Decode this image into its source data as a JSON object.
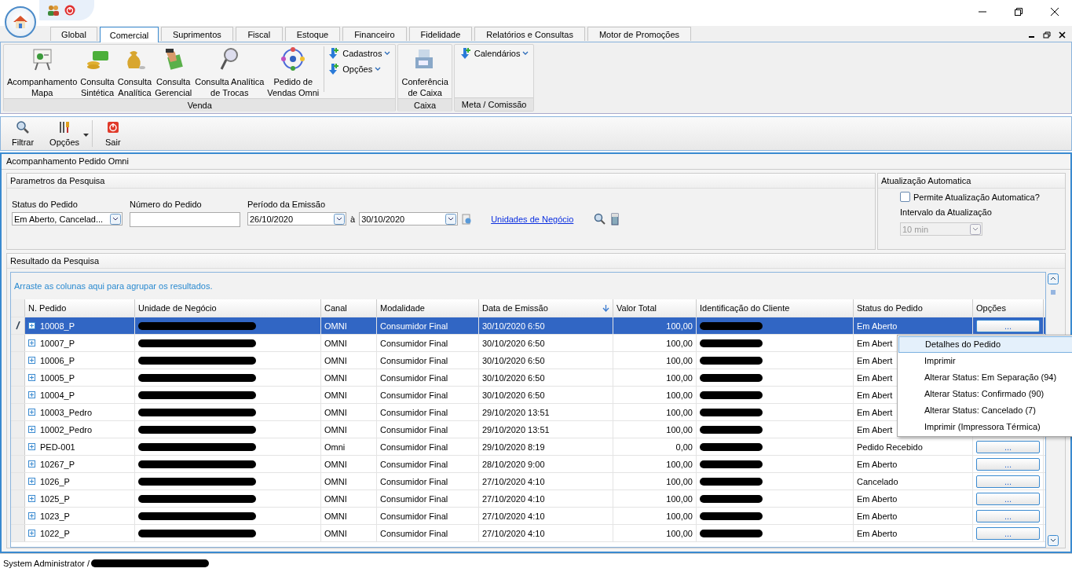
{
  "tabs": [
    {
      "label": "Global",
      "selected": false
    },
    {
      "label": "Comercial",
      "selected": true
    },
    {
      "label": "Suprimentos",
      "selected": false
    },
    {
      "label": "Fiscal",
      "selected": false
    },
    {
      "label": "Estoque",
      "selected": false
    },
    {
      "label": "Financeiro",
      "selected": false
    },
    {
      "label": "Fidelidade",
      "selected": false
    },
    {
      "label": "Relatórios e Consultas",
      "selected": false
    },
    {
      "label": "Motor de Promoções",
      "selected": false
    }
  ],
  "ribbon_groups": [
    {
      "label": "Venda",
      "buttons": [
        {
          "lines": [
            "Acompanhamento",
            "Mapa"
          ],
          "kind": "board"
        },
        {
          "lines": [
            "Consulta",
            "Sintética"
          ],
          "kind": "money"
        },
        {
          "lines": [
            "Consulta",
            "Analítica"
          ],
          "kind": "bag"
        },
        {
          "lines": [
            "Consulta",
            "Gerencial"
          ],
          "kind": "hand"
        },
        {
          "lines": [
            "Consulta Analítica",
            "de Trocas"
          ],
          "kind": "magnifier"
        },
        {
          "lines": [
            "Pedido de",
            "Vendas Omni"
          ],
          "kind": "network"
        }
      ],
      "menus": [
        "Cadastros",
        "Opções"
      ]
    },
    {
      "label": "Caixa",
      "buttons": [
        {
          "lines": [
            "Conferência",
            "de Caixa"
          ],
          "kind": "register"
        }
      ]
    },
    {
      "label": "Meta / Comissão",
      "menus": [
        "Calendários"
      ]
    }
  ],
  "toolbar": [
    {
      "label": "Filtrar",
      "kind": "search",
      "dropdown": false
    },
    {
      "label": "Opções",
      "kind": "tools",
      "dropdown": true
    },
    {
      "label": "Sair",
      "kind": "exit",
      "dropdown": false
    }
  ],
  "panel_title": "Acompanhamento Pedido Omni",
  "search": {
    "title": "Parametros da Pesquisa",
    "status_label": "Status do Pedido",
    "status_value": "Em Aberto, Cancelad...",
    "number_label": "Número do Pedido",
    "period_label": "Período da Emissão",
    "date_from": "26/10/2020",
    "separator": "à",
    "date_to": "30/10/2020",
    "link": "Unidades de Negócio"
  },
  "auto_update": {
    "title": "Atualização Automatica",
    "checkbox_label": "Permite Atualização Automatica?",
    "checked": false,
    "interval_label": "Intervalo da Atualização",
    "interval_value": "10 min",
    "disabled": true
  },
  "results": {
    "title": "Resultado da Pesquisa",
    "group_hint": "Arraste as colunas aqui para agrupar os resultados.",
    "columns": [
      "N. Pedido",
      "Unidade de Negócio",
      "Canal",
      "Modalidade",
      "Data de Emissão",
      "Valor Total",
      "Identificação do Cliente",
      "Status do Pedido",
      "Opções"
    ],
    "rows": [
      {
        "order": "10008_P",
        "channel": "OMNI",
        "mode": "Consumidor Final",
        "date": "30/10/2020 6:50",
        "total": "100,00",
        "status": "Em Aberto",
        "selected": true,
        "button": "..."
      },
      {
        "order": "10007_P",
        "channel": "OMNI",
        "mode": "Consumidor Final",
        "date": "30/10/2020 6:50",
        "total": "100,00",
        "status": "Em Abert",
        "selected": false
      },
      {
        "order": "10006_P",
        "channel": "OMNI",
        "mode": "Consumidor Final",
        "date": "30/10/2020 6:50",
        "total": "100,00",
        "status": "Em Abert",
        "selected": false
      },
      {
        "order": "10005_P",
        "channel": "OMNI",
        "mode": "Consumidor Final",
        "date": "30/10/2020 6:50",
        "total": "100,00",
        "status": "Em Abert",
        "selected": false
      },
      {
        "order": "10004_P",
        "channel": "OMNI",
        "mode": "Consumidor Final",
        "date": "30/10/2020 6:50",
        "total": "100,00",
        "status": "Em Abert",
        "selected": false
      },
      {
        "order": "10003_Pedro",
        "channel": "OMNI",
        "mode": "Consumidor Final",
        "date": "29/10/2020 13:51",
        "total": "100,00",
        "status": "Em Abert",
        "selected": false
      },
      {
        "order": "10002_Pedro",
        "channel": "OMNI",
        "mode": "Consumidor Final",
        "date": "29/10/2020 13:51",
        "total": "100,00",
        "status": "Em Abert",
        "selected": false
      },
      {
        "order": "PED-001",
        "channel": "Omni",
        "mode": "Consumidor Final",
        "date": "29/10/2020 8:19",
        "total": "0,00",
        "status": "Pedido Recebido",
        "selected": false,
        "button": "..."
      },
      {
        "order": "10267_P",
        "channel": "OMNI",
        "mode": "Consumidor Final",
        "date": "28/10/2020 9:00",
        "total": "100,00",
        "status": "Em Aberto",
        "selected": false,
        "button": "..."
      },
      {
        "order": "1026_P",
        "channel": "OMNI",
        "mode": "Consumidor Final",
        "date": "27/10/2020 4:10",
        "total": "100,00",
        "status": "Cancelado",
        "selected": false,
        "button": "..."
      },
      {
        "order": "1025_P",
        "channel": "OMNI",
        "mode": "Consumidor Final",
        "date": "27/10/2020 4:10",
        "total": "100,00",
        "status": "Em Aberto",
        "selected": false,
        "button": "..."
      },
      {
        "order": "1023_P",
        "channel": "OMNI",
        "mode": "Consumidor Final",
        "date": "27/10/2020 4:10",
        "total": "100,00",
        "status": "Em Aberto",
        "selected": false,
        "button": "..."
      },
      {
        "order": "1022_P",
        "channel": "OMNI",
        "mode": "Consumidor Final",
        "date": "27/10/2020 4:10",
        "total": "100,00",
        "status": "Em Aberto",
        "selected": false,
        "button": "..."
      }
    ]
  },
  "context_menu": [
    {
      "label": "Detalhes do Pedido",
      "selected": true
    },
    {
      "label": "Imprimir",
      "selected": false
    },
    {
      "label": "Alterar Status: Em Separação (94)",
      "selected": false
    },
    {
      "label": "Alterar Status: Confirmado (90)",
      "selected": false
    },
    {
      "label": "Alterar Status: Cancelado (7)",
      "selected": false
    },
    {
      "label": "Imprimir (Impressora Térmica)",
      "selected": false
    }
  ],
  "status_bar": {
    "user": "System Administrator /"
  }
}
